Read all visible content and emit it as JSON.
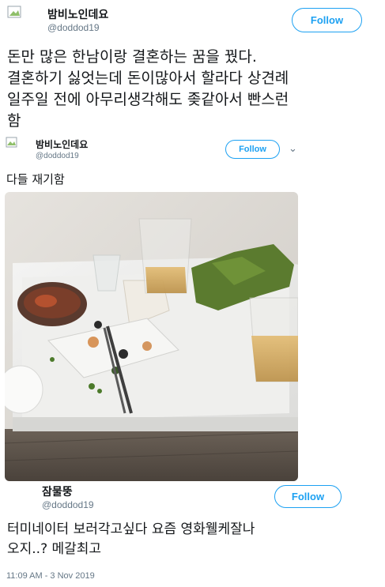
{
  "tweet1": {
    "name": "밤비노인데요",
    "handle": "@doddod19",
    "follow_label": "Follow",
    "text_lines": [
      "돈만 많은 한남이랑 결혼하는 꿈을 꿨다.",
      "결혼하기 싫엇는데 돈이많아서 할라다 상견례",
      "일주일 전에 아무리생각해도 좆같아서 빤스런",
      "함"
    ]
  },
  "tweet2": {
    "name": "밤비노인데요",
    "handle": "@doddod19",
    "follow_label": "Follow",
    "text": "다들 재기함",
    "image_desc": "tray-food-photo"
  },
  "tweet3": {
    "name": "잠물뚱",
    "handle": "@doddod19",
    "follow_label": "Follow",
    "text_lines": [
      "터미네이터 보러각고싶다 요즘 영화웰케잘나",
      "오지..? 메갈최고"
    ],
    "timestamp": "11:09 AM - 3 Nov 2019"
  },
  "colors": {
    "accent": "#1da1f2",
    "text": "#14171a",
    "muted": "#657786"
  }
}
